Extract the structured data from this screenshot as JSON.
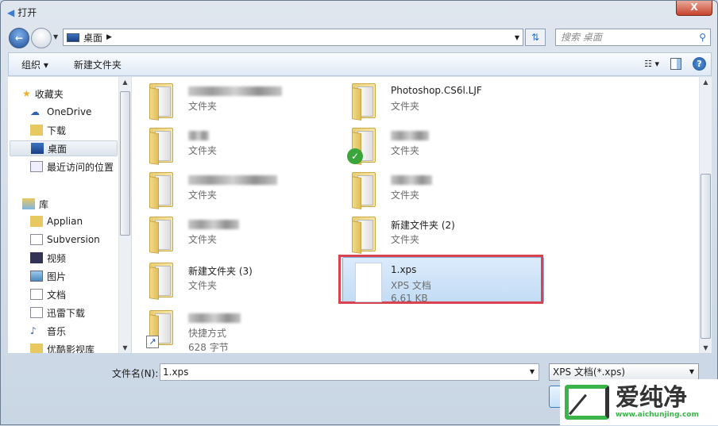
{
  "window": {
    "title": "打开",
    "close_label": "X"
  },
  "address": {
    "location": "桌面",
    "search_placeholder": "搜索 桌面"
  },
  "toolbar": {
    "organize": "组织 ▾",
    "new_folder": "新建文件夹"
  },
  "nav": {
    "favorites": "收藏夹",
    "favorites_items": [
      "OneDrive",
      "下载",
      "桌面",
      "最近访问的位置"
    ],
    "libraries": "库",
    "library_items": [
      "Applian",
      "Subversion",
      "视频",
      "图片",
      "文档",
      "迅雷下载",
      "音乐",
      "优酷影视库"
    ],
    "selected": "桌面"
  },
  "files": [
    {
      "name": "",
      "type": "文件夹",
      "blurred": true
    },
    {
      "name": "Photoshop.CS6l.LJF",
      "type": "文件夹"
    },
    {
      "name": "",
      "type": "文件夹",
      "blurred": true
    },
    {
      "name": "",
      "type": "文件夹",
      "blurred": true,
      "synced": true
    },
    {
      "name": "",
      "type": "文件夹",
      "blurred": true
    },
    {
      "name": "",
      "type": "文件夹",
      "blurred": true
    },
    {
      "name": "",
      "type": "文件夹",
      "blurred": true
    },
    {
      "name": "新建文件夹 (2)",
      "type": "文件夹"
    },
    {
      "name": "新建文件夹 (3)",
      "type": "文件夹"
    },
    {
      "name": "1.xps",
      "type": "XPS 文档",
      "size": "6.61 KB",
      "selected": true
    },
    {
      "name": "",
      "type": "快捷方式",
      "size": "628 字节",
      "blurred": true,
      "shortcut": true
    }
  ],
  "bottom": {
    "filename_label": "文件名(N):",
    "filename_value": "1.xps",
    "filetype": "XPS 文档(*.xps)"
  },
  "watermark": {
    "brand": "爱纯净",
    "url": "www.aichunjing.com"
  },
  "colors": {
    "highlight": "#d9434f",
    "selection": "#c2dcf5",
    "brand_green": "#39b54a"
  }
}
